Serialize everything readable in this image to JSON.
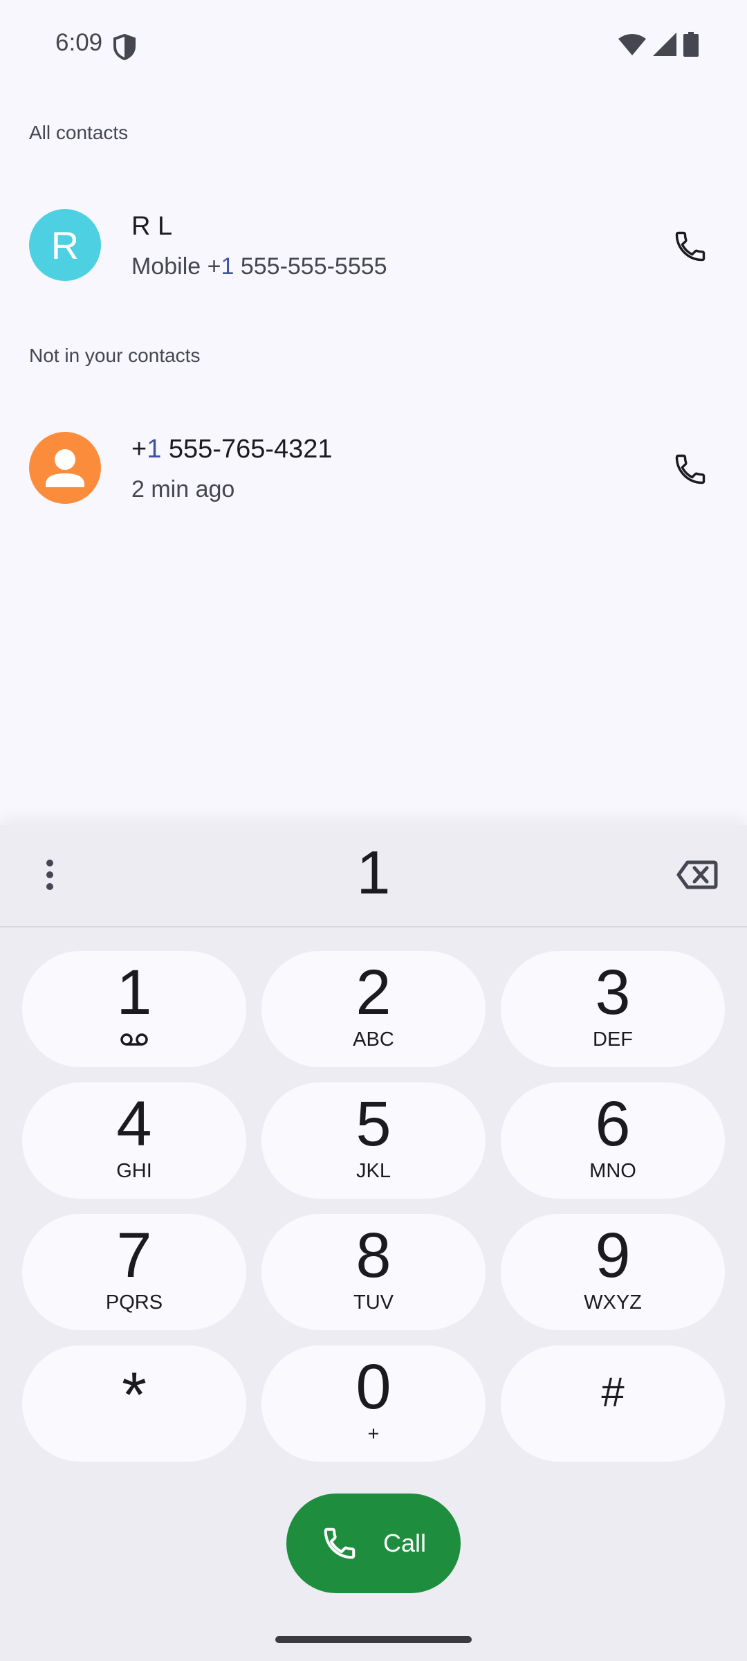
{
  "status_bar": {
    "time": "6:09",
    "icons": [
      "shield-icon",
      "wifi-icon",
      "signal-icon",
      "battery-icon"
    ]
  },
  "sections": {
    "all_contacts": "All contacts",
    "not_in_contacts": "Not in your contacts"
  },
  "contacts": [
    {
      "avatar_letter": "R",
      "avatar_color": "#4dd0e1",
      "name": "R L",
      "sub_prefix": "Mobile +",
      "sub_accent": "1",
      "sub_suffix": " 555-555-5555"
    }
  ],
  "recent": [
    {
      "avatar_icon": "person-icon",
      "avatar_color": "#fb8c3c",
      "number_prefix": "+",
      "number_accent": "1",
      "number_suffix": " 555-765-4321",
      "time": "2 min ago"
    }
  ],
  "dialpad": {
    "typed_digits": "1",
    "keys": [
      {
        "digit": "1",
        "letters": "",
        "icon": "voicemail-icon"
      },
      {
        "digit": "2",
        "letters": "ABC"
      },
      {
        "digit": "3",
        "letters": "DEF"
      },
      {
        "digit": "4",
        "letters": "GHI"
      },
      {
        "digit": "5",
        "letters": "JKL"
      },
      {
        "digit": "6",
        "letters": "MNO"
      },
      {
        "digit": "7",
        "letters": "PQRS"
      },
      {
        "digit": "8",
        "letters": "TUV"
      },
      {
        "digit": "9",
        "letters": "WXYZ"
      },
      {
        "digit": "*",
        "letters": ""
      },
      {
        "digit": "0",
        "letters": "+"
      },
      {
        "digit": "#",
        "letters": ""
      }
    ],
    "call_label": "Call"
  },
  "colors": {
    "call_green": "#1e8e3e",
    "background": "#f7f7fd",
    "dialpad_bg": "#edecf2"
  }
}
